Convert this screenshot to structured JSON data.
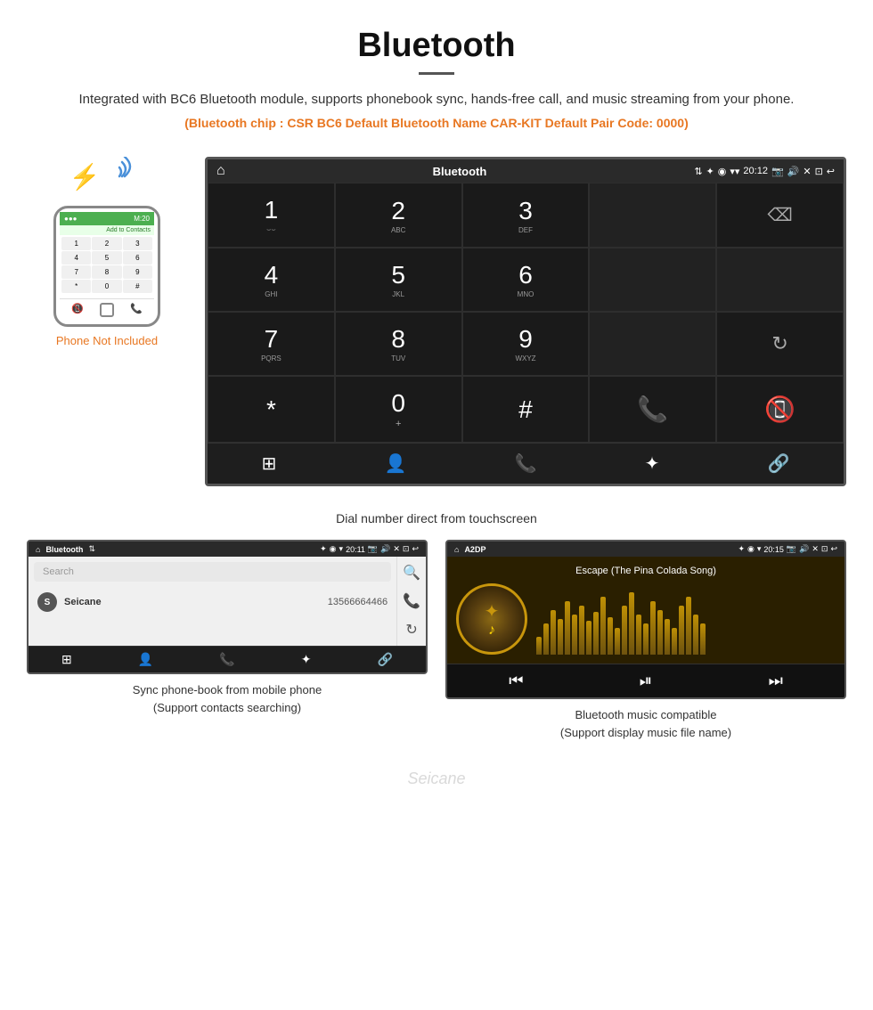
{
  "page": {
    "title": "Bluetooth",
    "description": "Integrated with BC6 Bluetooth module, supports phonebook sync, hands-free call, and music streaming from your phone.",
    "specs": "(Bluetooth chip : CSR BC6   Default Bluetooth Name CAR-KIT    Default Pair Code: 0000)",
    "caption_main": "Dial number direct from touchscreen",
    "caption_left": "Sync phone-book from mobile phone\n(Support contacts searching)",
    "caption_right": "Bluetooth music compatible\n(Support display music file name)"
  },
  "screen_main": {
    "status_bar": {
      "home": "⌂",
      "label": "Bluetooth",
      "usb": "↑",
      "bluetooth": "✦",
      "location": "◉",
      "signal": "▾",
      "time": "20:12",
      "camera": "📷",
      "volume": "♪",
      "battery": "▭",
      "back": "↩"
    },
    "dialpad": {
      "keys": [
        {
          "num": "1",
          "sub": "◡◡"
        },
        {
          "num": "2",
          "sub": "ABC"
        },
        {
          "num": "3",
          "sub": "DEF"
        },
        {
          "num": "",
          "sub": ""
        },
        {
          "num": "⌫",
          "sub": ""
        },
        {
          "num": "4",
          "sub": "GHI"
        },
        {
          "num": "5",
          "sub": "JKL"
        },
        {
          "num": "6",
          "sub": "MNO"
        },
        {
          "num": "",
          "sub": ""
        },
        {
          "num": "",
          "sub": ""
        },
        {
          "num": "7",
          "sub": "PQRS"
        },
        {
          "num": "8",
          "sub": "TUV"
        },
        {
          "num": "9",
          "sub": "WXYZ"
        },
        {
          "num": "",
          "sub": ""
        },
        {
          "num": "↻",
          "sub": ""
        },
        {
          "num": "*",
          "sub": ""
        },
        {
          "num": "0+",
          "sub": ""
        },
        {
          "num": "#",
          "sub": ""
        },
        {
          "num": "📞",
          "sub": "call"
        },
        {
          "num": "📵",
          "sub": "end"
        }
      ],
      "bottom_icons": [
        "⊞",
        "👤",
        "📞",
        "✦",
        "🔗"
      ]
    }
  },
  "screen_phonebook": {
    "status_bar": {
      "label": "Bluetooth",
      "time": "20:11"
    },
    "search_placeholder": "Search",
    "contacts": [
      {
        "initial": "S",
        "name": "Seicane",
        "phone": "13566664466"
      }
    ],
    "side_icons": [
      "🔍",
      "📞",
      "↻"
    ],
    "bottom_icons": [
      "⊞",
      "👤",
      "📞",
      "✦",
      "🔗"
    ]
  },
  "screen_music": {
    "status_bar": {
      "label": "A2DP",
      "time": "20:15"
    },
    "song_title": "Escape (The Pina Colada Song)",
    "eq_heights": [
      20,
      35,
      50,
      40,
      60,
      45,
      55,
      38,
      48,
      65,
      42,
      30,
      55,
      70,
      45,
      35,
      60,
      50,
      40,
      30,
      55,
      65,
      45,
      35
    ],
    "bottom_icons": [
      "⏮",
      "⏯",
      "⏭"
    ]
  },
  "phone_mock": {
    "top_label": "M:20",
    "add_label": "Add to Contacts",
    "keys": [
      "1",
      "2",
      "3",
      "4",
      "5",
      "6",
      "7",
      "8",
      "9",
      "*",
      "0",
      "#"
    ],
    "bottom_icons": [
      "📞",
      "✕",
      "📞"
    ],
    "not_included": "Phone Not Included"
  },
  "bluetooth_icon": "⚡",
  "watermark": "Seicane"
}
